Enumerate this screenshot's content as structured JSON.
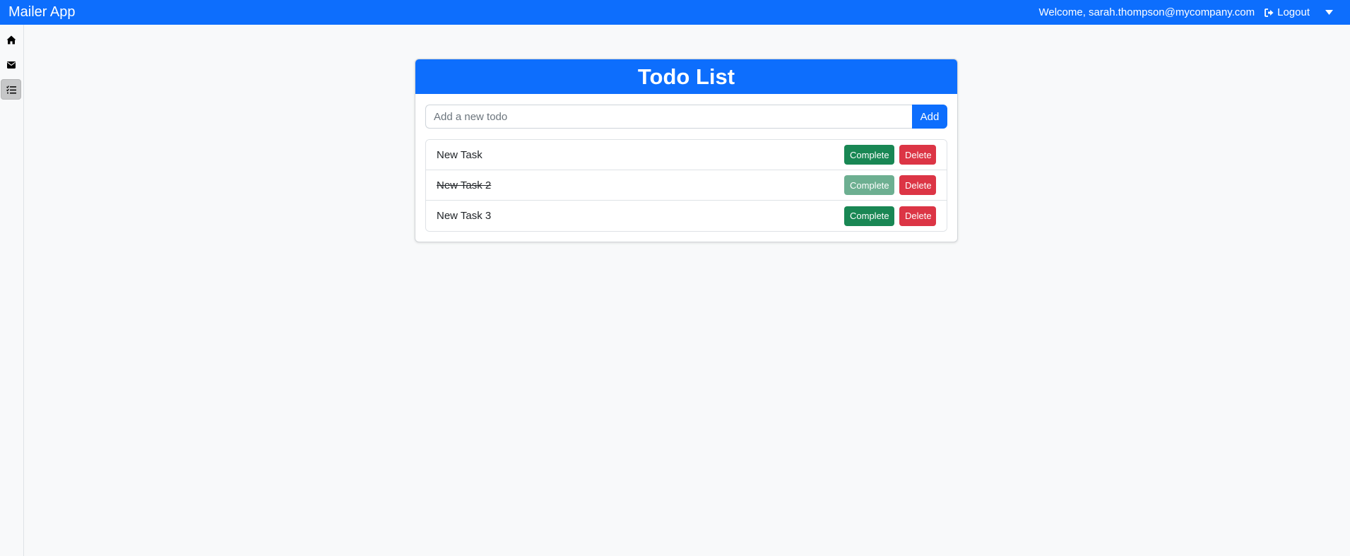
{
  "navbar": {
    "brand": "Mailer App",
    "welcome": "Welcome, sarah.thompson@mycompany.com",
    "logout_label": "Logout",
    "color": "#0d6efd"
  },
  "sidebar": {
    "items": [
      {
        "icon": "home-icon",
        "active": false
      },
      {
        "icon": "envelope-icon",
        "active": false
      },
      {
        "icon": "tasks-icon",
        "active": true
      }
    ]
  },
  "todo": {
    "title": "Todo List",
    "input_placeholder": "Add a new todo",
    "input_value": "",
    "add_label": "Add",
    "complete_label": "Complete",
    "delete_label": "Delete",
    "items": [
      {
        "text": "New Task",
        "completed": false
      },
      {
        "text": "New Task 2",
        "completed": true
      },
      {
        "text": "New Task 3",
        "completed": false
      }
    ]
  },
  "colors": {
    "primary": "#0d6efd",
    "success": "#198754",
    "danger": "#dc3545"
  }
}
